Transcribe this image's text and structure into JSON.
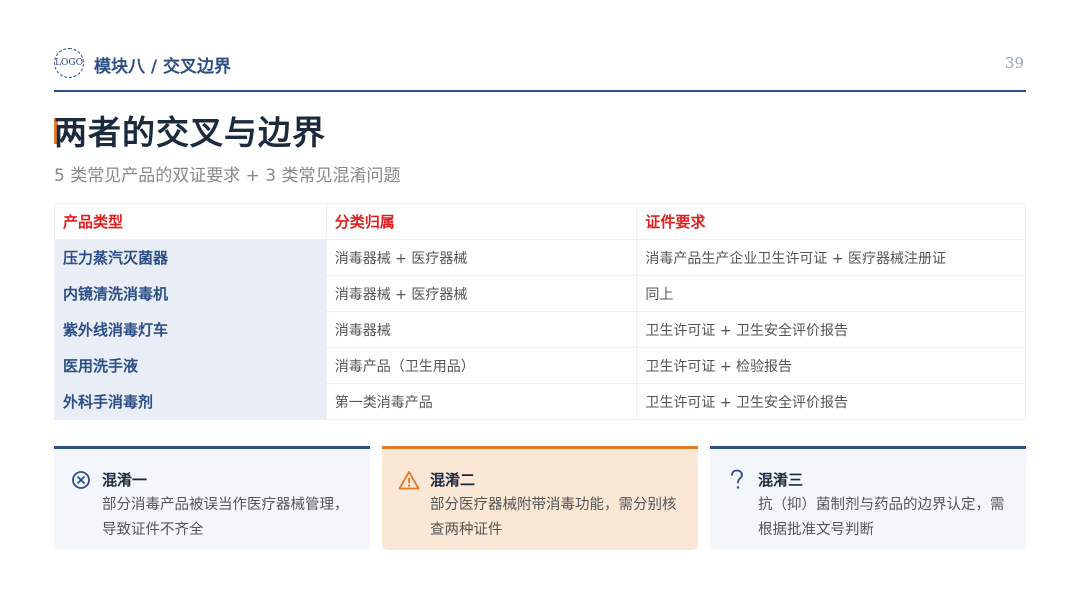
{
  "header": {
    "logo_text": "LOGO",
    "module_title": "模块八 / 交叉边界",
    "page_number": "39"
  },
  "title": "两者的交叉与边界",
  "subtitle": "5 类常见产品的双证要求 + 3 类常见混淆问题",
  "table": {
    "headers": [
      "产品类型",
      "分类归属",
      "证件要求"
    ],
    "rows": [
      [
        "压力蒸汽灭菌器",
        "消毒器械 + 医疗器械",
        "消毒产品生产企业卫生许可证 + 医疗器械注册证"
      ],
      [
        "内镜清洗消毒机",
        "消毒器械 + 医疗器械",
        "同上"
      ],
      [
        "紫外线消毒灯车",
        "消毒器械",
        "卫生许可证 + 卫生安全评价报告"
      ],
      [
        "医用洗手液",
        "消毒产品（卫生用品）",
        "卫生许可证 + 检验报告"
      ],
      [
        "外科手消毒剂",
        "第一类消毒产品",
        "卫生许可证 + 卫生安全评价报告"
      ]
    ]
  },
  "cards": [
    {
      "icon": "circle-x-icon",
      "heading": "混淆一",
      "body": "部分消毒产品被误当作医疗器械管理，导致证件不齐全"
    },
    {
      "icon": "warning-triangle-icon",
      "heading": "混淆二",
      "body": "部分医疗器械附带消毒功能，需分别核查两种证件"
    },
    {
      "icon": "question-mark-icon",
      "heading": "混淆三",
      "body": "抗（抑）菌制剂与药品的边界认定，需根据批准文号判断"
    }
  ],
  "colors": {
    "primary": "#2c4f86",
    "accent": "#e07b2a",
    "header_red": "#e02020"
  }
}
